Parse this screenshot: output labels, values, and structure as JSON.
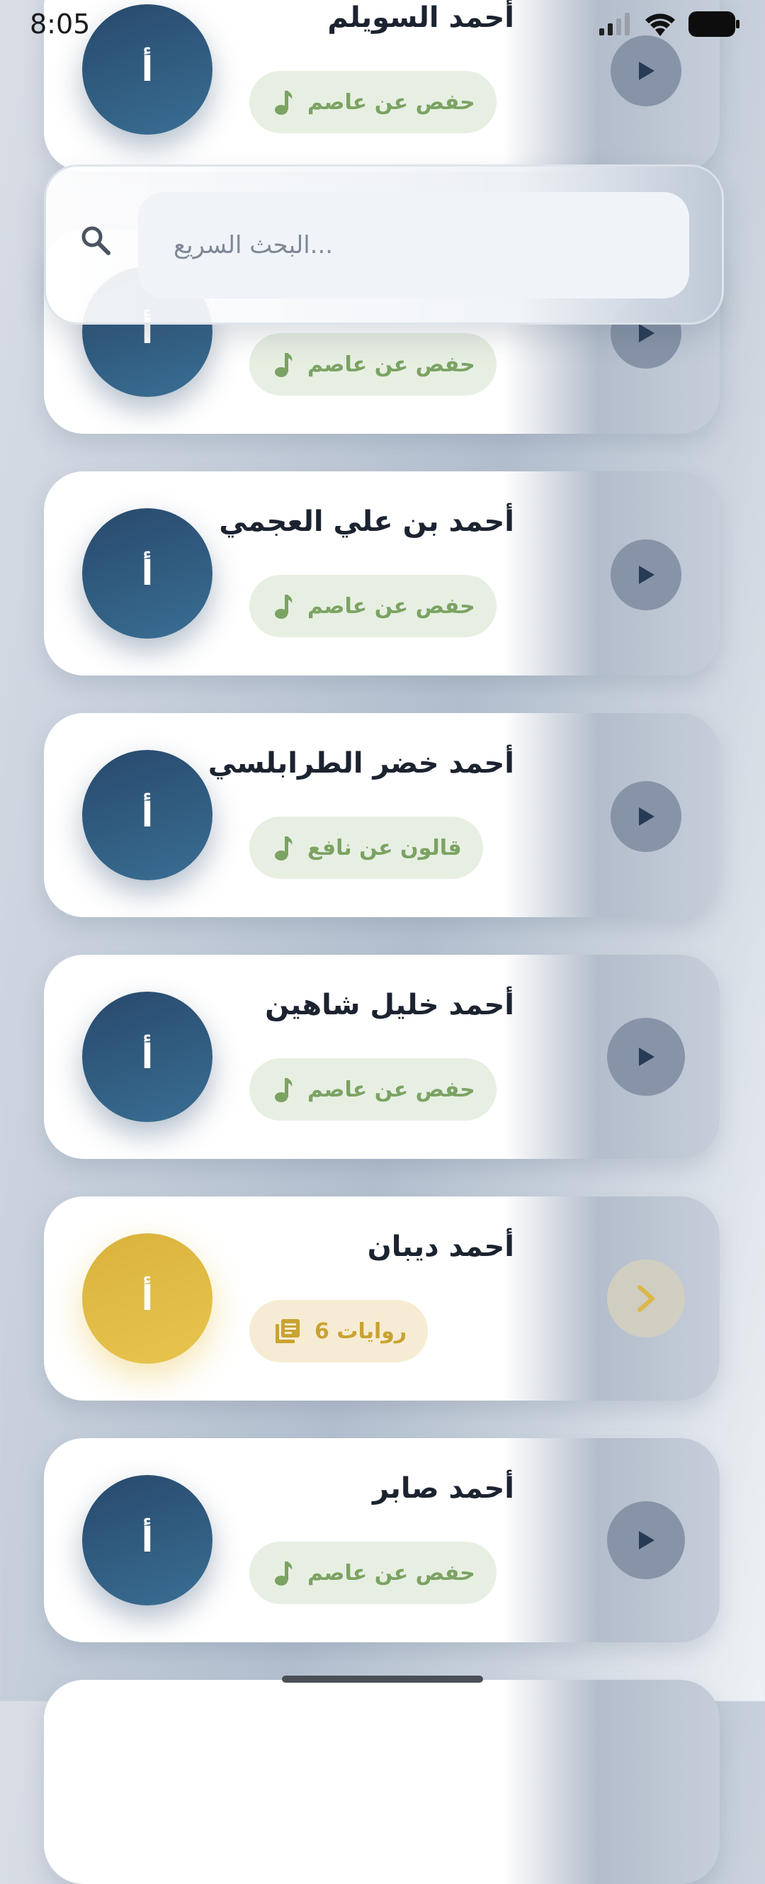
{
  "status_bar": {
    "time": "8:05"
  },
  "search": {
    "placeholder": "...البحث السريع"
  },
  "reciters": [
    {
      "initial": "أ",
      "name": "أحمد السويلم",
      "riwaya": "حفص عن عاصم",
      "kind": "single"
    },
    {
      "initial": "أ",
      "name": "",
      "riwaya": "حفص عن عاصم",
      "kind": "single"
    },
    {
      "initial": "أ",
      "name": "أحمد بن علي العجمي",
      "riwaya": "حفص عن عاصم",
      "kind": "single"
    },
    {
      "initial": "أ",
      "name": "أحمد خضر الطرابلسي",
      "riwaya": "قالون عن نافع",
      "kind": "single"
    },
    {
      "initial": "أ",
      "name": "أحمد خليل شاهين",
      "riwaya": "حفص عن عاصم",
      "kind": "single"
    },
    {
      "initial": "أ",
      "name": "أحمد ديبان",
      "riwaya": "روايات 6",
      "kind": "multi"
    },
    {
      "initial": "أ",
      "name": "أحمد صابر",
      "riwaya": "حفص عن عاصم",
      "kind": "single"
    }
  ],
  "colors": {
    "avatar_blue": "#2f5b80",
    "avatar_gold": "#e2bb44",
    "tag_green_text": "#7ba363",
    "tag_gold_text": "#c9a232",
    "play_button": "#8794a8"
  },
  "icons": {
    "tag_single": "music-note-icon",
    "tag_multi": "library-books-icon",
    "action_single": "play-icon",
    "action_multi": "chevron-right-icon"
  }
}
